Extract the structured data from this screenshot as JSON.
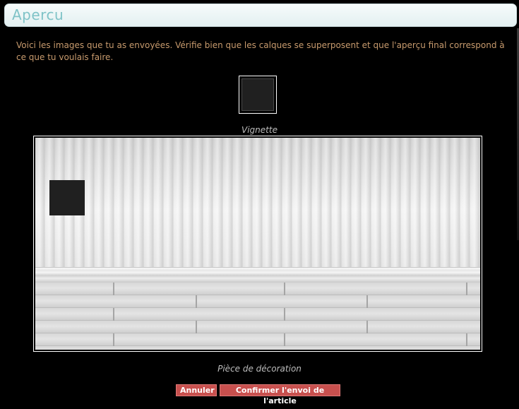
{
  "header": {
    "title": "Apercu"
  },
  "intro": {
    "text": "Voici les images que tu as envoyées. Vérifie bien que les calques se superposent et que l'aperçu final correspond à ce que tu voulais faire."
  },
  "thumbnail": {
    "caption": "Vignette"
  },
  "preview": {
    "caption": "Pièce de décoration"
  },
  "actions": {
    "cancel_label": "Annuler",
    "confirm_label": "Confirmer l'envoi de l'article"
  },
  "colors": {
    "title": "#7fc3c7",
    "intro_text": "#c79a6d",
    "button_bg": "#c8504e"
  }
}
